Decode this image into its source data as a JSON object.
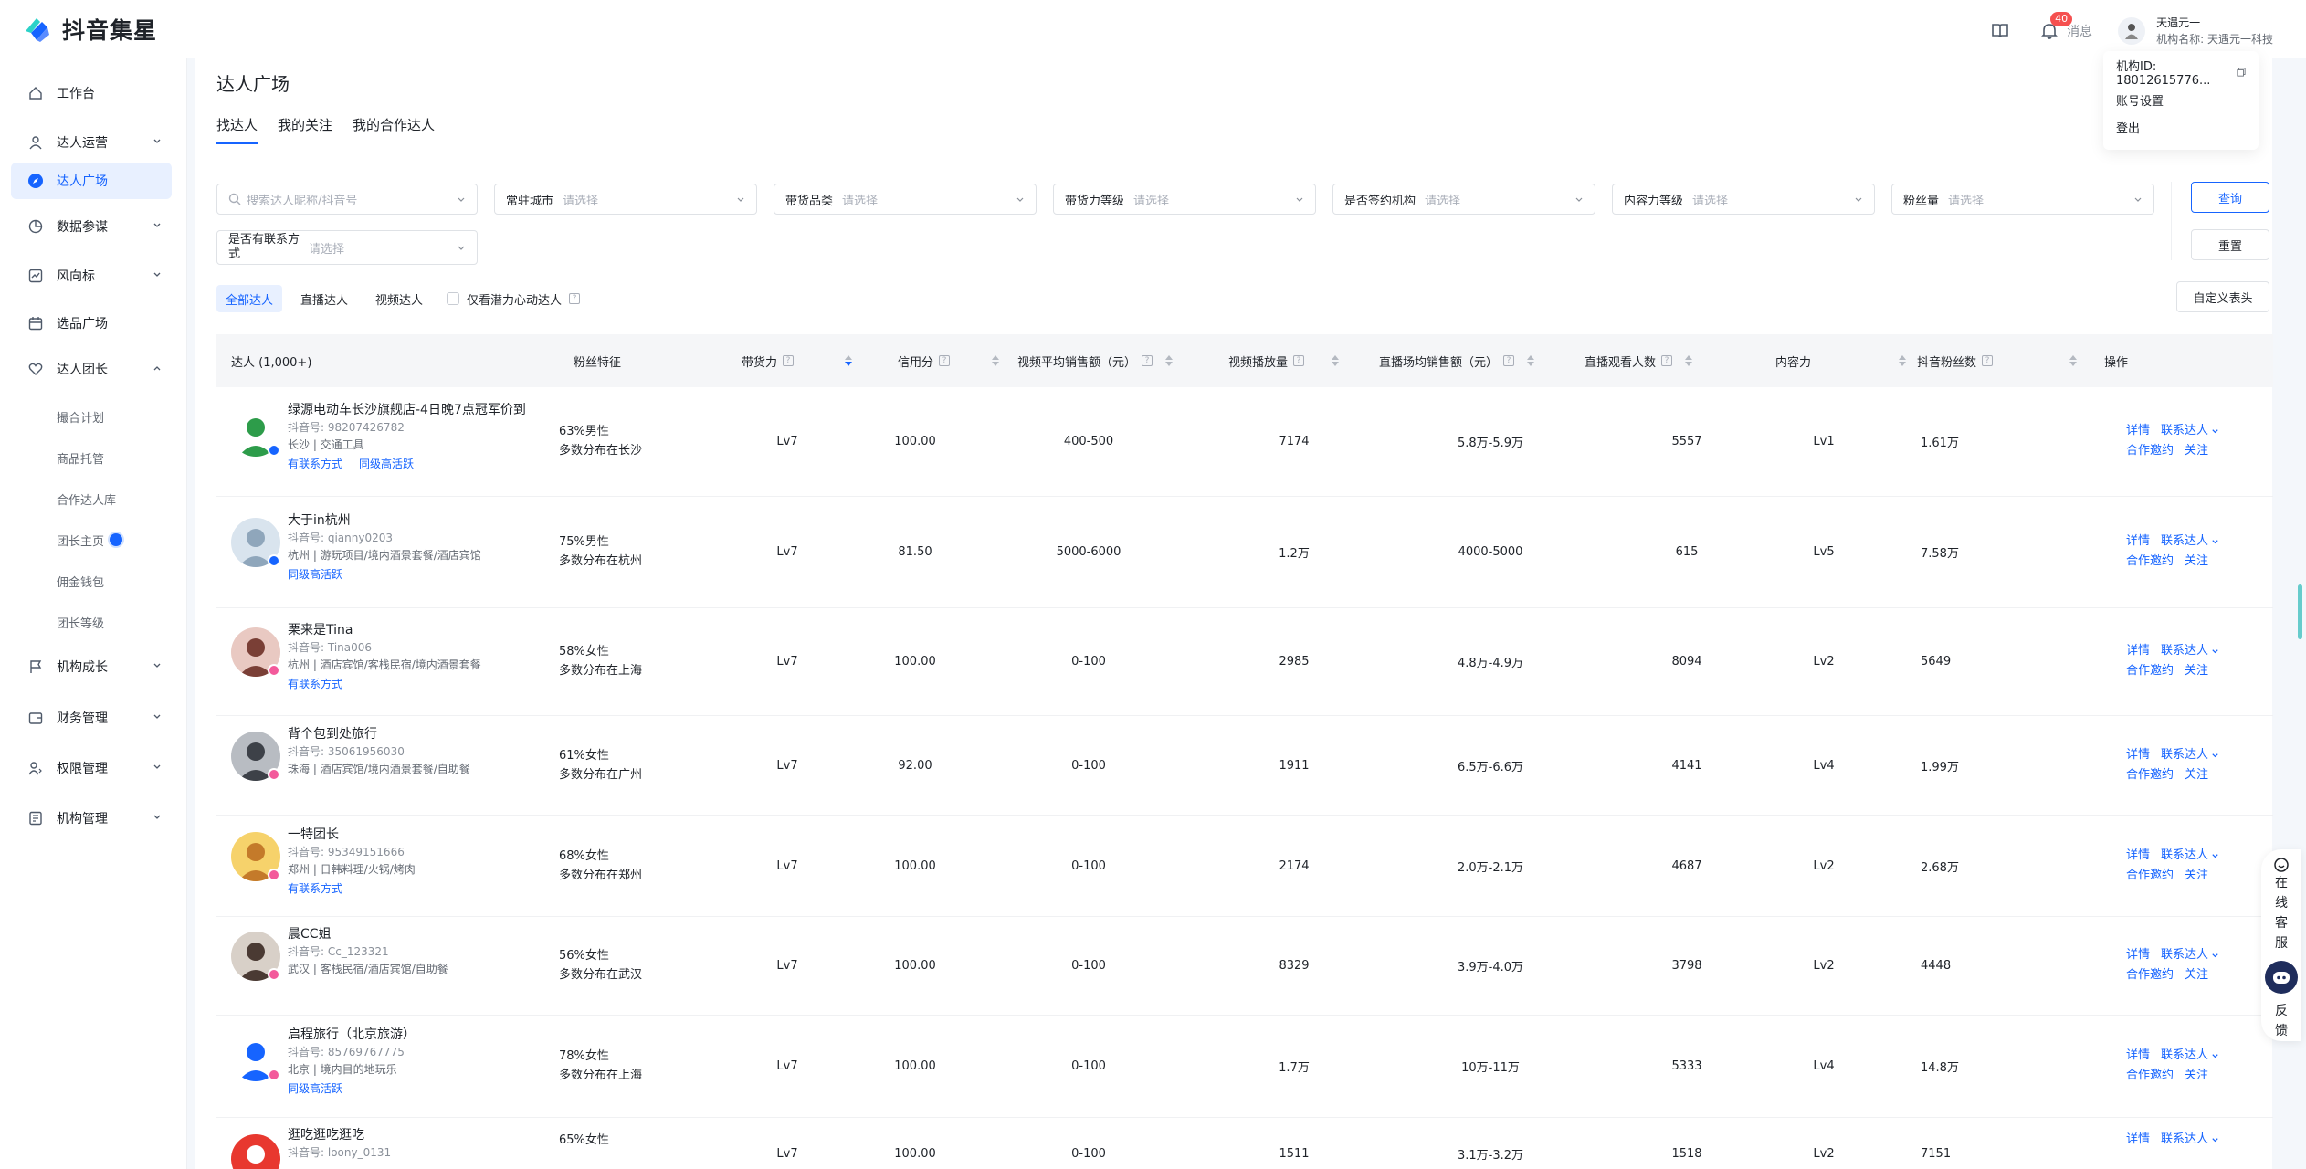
{
  "app": {
    "name": "抖音集星"
  },
  "header": {
    "message_label": "消息",
    "message_count": "40",
    "user_name": "天遇元一",
    "org_line": "机构名称: 天遇元一科技"
  },
  "user_menu": {
    "org_id": "机构ID: 18012615776...",
    "account_settings": "账号设置",
    "logout": "登出"
  },
  "sidebar": {
    "items": [
      {
        "label": "工作台"
      },
      {
        "label": "达人运营"
      },
      {
        "label": "达人广场"
      },
      {
        "label": "数据参谋"
      },
      {
        "label": "风向标"
      },
      {
        "label": "选品广场"
      },
      {
        "label": "达人团长"
      },
      {
        "label": "机构成长"
      },
      {
        "label": "财务管理"
      },
      {
        "label": "权限管理"
      },
      {
        "label": "机构管理"
      }
    ],
    "sub_items": [
      {
        "label": "撮合计划"
      },
      {
        "label": "商品托管"
      },
      {
        "label": "合作达人库"
      },
      {
        "label": "团长主页"
      },
      {
        "label": "佣金钱包"
      },
      {
        "label": "团长等级"
      }
    ]
  },
  "page": {
    "title": "达人广场",
    "tabs": [
      {
        "label": "找达人"
      },
      {
        "label": "我的关注"
      },
      {
        "label": "我的合作达人"
      }
    ]
  },
  "filters": {
    "search_placeholder": "搜索达人昵称/抖音号",
    "items": [
      {
        "label": "常驻城市",
        "placeholder": "请选择"
      },
      {
        "label": "带货品类",
        "placeholder": "请选择"
      },
      {
        "label": "带货力等级",
        "placeholder": "请选择"
      },
      {
        "label": "是否签约机构",
        "placeholder": "请选择"
      },
      {
        "label": "内容力等级",
        "placeholder": "请选择"
      },
      {
        "label": "粉丝量",
        "placeholder": "请选择"
      }
    ],
    "contact_label_1": "是否有联系方",
    "contact_label_2": "式",
    "contact_placeholder": "请选择",
    "query_button": "查询",
    "reset_button": "重置"
  },
  "type_filter": {
    "options": [
      {
        "label": "全部达人"
      },
      {
        "label": "直播达人"
      },
      {
        "label": "视频达人"
      }
    ],
    "potential_label": "仅看潜力心动达人",
    "custom_header_button": "自定义表头"
  },
  "table": {
    "headers": {
      "talent": "达人 (1,000+)",
      "fans": "粉丝特征",
      "sales_power": "带货力",
      "credit": "信用分",
      "video_sales": "视频平均销售额（元）",
      "video_plays": "视频播放量",
      "live_sales": "直播场均销售额（元）",
      "live_viewers": "直播观看人数",
      "content_power": "内容力",
      "dy_fans": "抖音粉丝数",
      "actions": "操作"
    },
    "action_labels": {
      "detail": "详情",
      "contact": "联系达人",
      "invite": "合作邀约",
      "follow": "关注"
    },
    "rows": [
      {
        "name": "绿源电动车长沙旗舰店-4日晚7点冠军价到",
        "dyid": "抖音号: 98207426782",
        "location": "长沙 | 交通工具",
        "tags": [
          "有联系方式",
          "同级高活跃"
        ],
        "fans_gender": "63%男性",
        "fans_city": "多数分布在长沙",
        "sales_power": "Lv7",
        "credit": "100.00",
        "video_sales": "400-500",
        "video_plays": "7174",
        "live_sales": "5.8万-5.9万",
        "live_viewers": "5557",
        "content_power": "Lv1",
        "dy_fans": "1.61万"
      },
      {
        "name": "大于in杭州",
        "dyid": "抖音号: qianny0203",
        "location": "杭州 | 游玩项目/境内酒景套餐/酒店宾馆",
        "tags": [
          "同级高活跃"
        ],
        "fans_gender": "75%男性",
        "fans_city": "多数分布在杭州",
        "sales_power": "Lv7",
        "credit": "81.50",
        "video_sales": "5000-6000",
        "video_plays": "1.2万",
        "live_sales": "4000-5000",
        "live_viewers": "615",
        "content_power": "Lv5",
        "dy_fans": "7.58万"
      },
      {
        "name": "栗来是Tina",
        "dyid": "抖音号: Tina006",
        "location": "杭州 | 酒店宾馆/客栈民宿/境内酒景套餐",
        "tags": [
          "有联系方式"
        ],
        "fans_gender": "58%女性",
        "fans_city": "多数分布在上海",
        "sales_power": "Lv7",
        "credit": "100.00",
        "video_sales": "0-100",
        "video_plays": "2985",
        "live_sales": "4.8万-4.9万",
        "live_viewers": "8094",
        "content_power": "Lv2",
        "dy_fans": "5649"
      },
      {
        "name": "背个包到处旅行",
        "dyid": "抖音号: 35061956030",
        "location": "珠海 | 酒店宾馆/境内酒景套餐/自助餐",
        "tags": [],
        "fans_gender": "61%女性",
        "fans_city": "多数分布在广州",
        "sales_power": "Lv7",
        "credit": "92.00",
        "video_sales": "0-100",
        "video_plays": "1911",
        "live_sales": "6.5万-6.6万",
        "live_viewers": "4141",
        "content_power": "Lv4",
        "dy_fans": "1.99万"
      },
      {
        "name": "一特团长",
        "dyid": "抖音号: 95349151666",
        "location": "郑州 | 日韩料理/火锅/烤肉",
        "tags": [
          "有联系方式"
        ],
        "fans_gender": "68%女性",
        "fans_city": "多数分布在郑州",
        "sales_power": "Lv7",
        "credit": "100.00",
        "video_sales": "0-100",
        "video_plays": "2174",
        "live_sales": "2.0万-2.1万",
        "live_viewers": "4687",
        "content_power": "Lv2",
        "dy_fans": "2.68万"
      },
      {
        "name": "晨CC姐",
        "dyid": "抖音号: Cc_123321",
        "location": "武汉 | 客栈民宿/酒店宾馆/自助餐",
        "tags": [],
        "fans_gender": "56%女性",
        "fans_city": "多数分布在武汉",
        "sales_power": "Lv7",
        "credit": "100.00",
        "video_sales": "0-100",
        "video_plays": "8329",
        "live_sales": "3.9万-4.0万",
        "live_viewers": "3798",
        "content_power": "Lv2",
        "dy_fans": "4448"
      },
      {
        "name": "启程旅行（北京旅游）",
        "dyid": "抖音号: 85769767775",
        "location": "北京 | 境内目的地玩乐",
        "tags": [
          "同级高活跃"
        ],
        "fans_gender": "78%女性",
        "fans_city": "多数分布在上海",
        "sales_power": "Lv7",
        "credit": "100.00",
        "video_sales": "0-100",
        "video_plays": "1.7万",
        "live_sales": "10万-11万",
        "live_viewers": "5333",
        "content_power": "Lv4",
        "dy_fans": "14.8万"
      },
      {
        "name": "逛吃逛吃逛吃",
        "dyid": "抖音号: loony_0131",
        "location": "",
        "tags": [],
        "fans_gender": "65%女性",
        "fans_city": "",
        "sales_power": "Lv7",
        "credit": "100.00",
        "video_sales": "0-100",
        "video_plays": "1511",
        "live_sales": "3.1万-3.2万",
        "live_viewers": "1518",
        "content_power": "Lv2",
        "dy_fans": "7151"
      }
    ]
  },
  "float_panel": {
    "text_top": [
      "在",
      "线",
      "客",
      "服"
    ],
    "text_bottom": [
      "反",
      "馈"
    ]
  },
  "colors": {
    "accent": "#1664ff",
    "badge": "#f5504f",
    "active_bg": "#e8f0ff"
  }
}
